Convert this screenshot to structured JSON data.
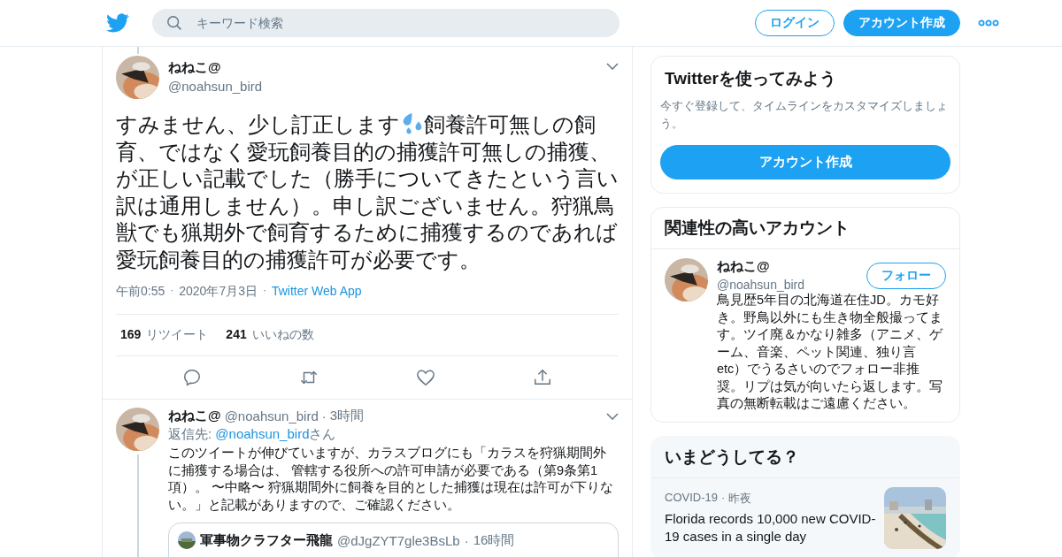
{
  "header": {
    "search": {
      "placeholder": "キーワード検索"
    },
    "login_button": "ログイン",
    "signup_button": "アカウント作成"
  },
  "tweet": {
    "name": "ねねこ@",
    "handle": "@noahsun_bird",
    "text_before": "すみません、少し訂正します",
    "text_after": "飼養許可無しの飼",
    "text_rest": "育、ではなく愛玩飼養目的の捕獲許可無しの捕獲、が正しい記載でした（勝手についてきたという言い訳は通用しません）。申し訳ございません。狩猟鳥獣でも猟期外で飼育するために捕獲するのであれば愛玩飼養目的の捕獲許可が必要です。",
    "time": "午前0:55",
    "date": "2020年7月3日",
    "source": "Twitter Web App",
    "separator": "·",
    "stats": [
      {
        "count": "169",
        "label": "リツイート"
      },
      {
        "count": "241",
        "label": "いいねの数"
      }
    ]
  },
  "reply": {
    "name": "ねねこ@",
    "handle": "@noahsun_bird",
    "time": "3時間",
    "separator": "·",
    "reply_to_label": "返信先: ",
    "reply_to_handle": "@noahsun_bird",
    "reply_to_suffix": "さん",
    "text": "このツイートが伸びていますが、カラスブログにも「カラスを狩猟期間外に捕獲する場合は、 管轄する役所への許可申請が必要である（第9条第1項）。 〜中略〜 狩猟期間外に飼養を目的とした捕獲は現在は許可が下りない。」と記載がありますので、ご確認ください。",
    "quote": {
      "name": "軍事物クラフター飛龍",
      "handle": "@dJgZYT7gle3BsLb",
      "time": "16時間",
      "separator": "·"
    }
  },
  "signup_card": {
    "title": "Twitterを使ってみよう",
    "text": "今すぐ登録して、タイムラインをカスタマイズしましょう。",
    "button": "アカウント作成"
  },
  "related": {
    "title": "関連性の高いアカウント",
    "account": {
      "name": "ねねこ@",
      "handle": "@noahsun_bird",
      "button": "フォロー",
      "bio": "鳥見歴5年目の北海道在住JD。カモ好き。野鳥以外にも生き物全般撮ってます。ツイ廃＆かなり雑多（アニメ、ゲーム、音楽、ペット関連、独り言etc）でうるさいのでフォロー非推奨。リプは気が向いたら返します。写真の無断転載はご遠慮ください。"
    }
  },
  "trends": {
    "title": "いまどうしてる？",
    "items": [
      {
        "category": "COVID-19",
        "time": "昨夜",
        "separator": "·",
        "headline": "Florida records 10,000 new COVID-19 cases in a single day"
      }
    ]
  }
}
